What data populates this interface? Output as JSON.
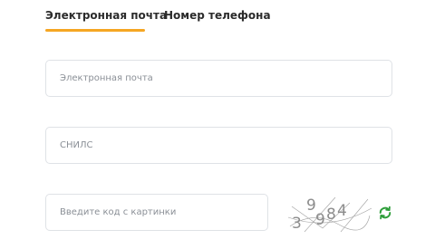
{
  "tabs": {
    "email_label": "Электронная почта",
    "phone_label": "Номер телефона",
    "active_color": "#f5a623"
  },
  "fields": {
    "email_placeholder": "Электронная почта",
    "snils_placeholder": "СНИЛС",
    "captcha_placeholder": "Введите код с картинки"
  },
  "captcha": {
    "text": "39984"
  },
  "icons": {
    "refresh": "refresh-icon"
  }
}
